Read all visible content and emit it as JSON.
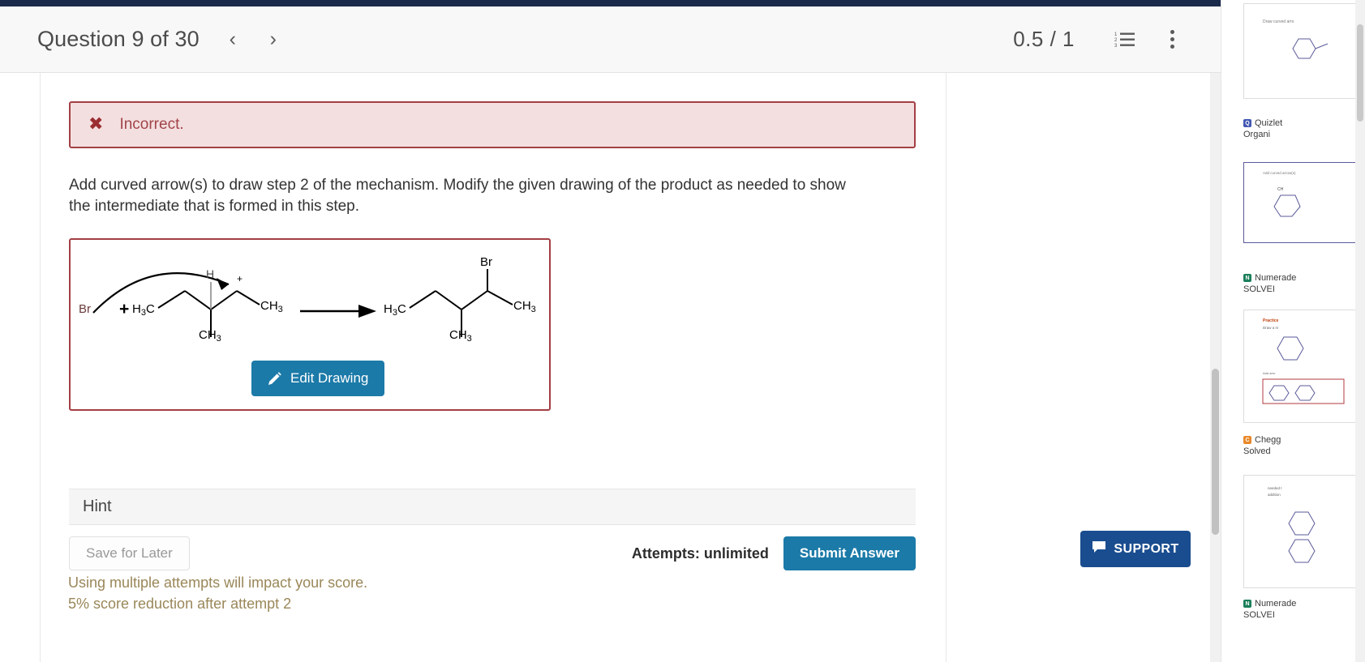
{
  "header": {
    "question_title": "Question 9 of 30",
    "prev_arrow": "‹",
    "next_arrow": "›",
    "score": "0.5 / 1",
    "list_icon_name": "numbered-list-icon",
    "kebab_icon_name": "more-options-icon"
  },
  "alert": {
    "icon": "✖",
    "text": "Incorrect.",
    "bg_color": "#f4dfe0",
    "border_color": "#a33f44",
    "text_color": "#a14449"
  },
  "prompt": {
    "text": "Add curved arrow(s) to draw step 2 of the mechanism. Modify the given drawing of the product as needed to show the intermediate that is formed in this step."
  },
  "drawing": {
    "border_color": "#a33f44",
    "edit_button_label": "Edit Drawing",
    "edit_button_color": "#1b7aa8",
    "pencil_icon_name": "pencil-icon",
    "reactant_labels": {
      "bromide": "Br",
      "plus_sign": "+",
      "methyl_left": "H3C",
      "hydrogen": "H",
      "charge": "+",
      "methyl_right": "CH3",
      "methyl_bottom": "CH3"
    },
    "product_labels": {
      "bromine": "Br",
      "methyl_left": "H3C",
      "methyl_right": "CH3",
      "methyl_bottom": "CH3"
    },
    "arrow_name": "reaction-arrow"
  },
  "hint": {
    "label": "Hint"
  },
  "actions": {
    "save_for_later": "Save for Later",
    "attempts": "Attempts: unlimited",
    "submit": "Submit Answer",
    "submit_color": "#1b7aa8"
  },
  "warnings": {
    "line1": "Using multiple attempts will impact your score.",
    "line2": "5% score reduction after attempt 2",
    "color": "#9a8759"
  },
  "support": {
    "label": "SUPPORT",
    "icon_name": "chat-bubble-icon",
    "color": "#1a4d8f"
  },
  "right_panel": {
    "results": [
      {
        "source": "Quizlet",
        "title": "Organi",
        "favicon_color": "#4257b2",
        "favicon_letter": "Q"
      },
      {
        "source": "Numerade",
        "title": "SOLVEI",
        "favicon_color": "#1a7f5a",
        "favicon_letter": "N"
      },
      {
        "source": "Chegg",
        "title": "Solved",
        "favicon_color": "#e8882a",
        "favicon_letter": "C"
      },
      {
        "source": "Numerade",
        "title": "SOLVEI",
        "favicon_color": "#1a7f5a",
        "favicon_letter": "N"
      }
    ],
    "snippets": [
      "Draw curved arro",
      "Add curved arrow(s)",
      "Practice",
      "Draw a m",
      "Add arro",
      "needed t",
      "addition"
    ]
  }
}
